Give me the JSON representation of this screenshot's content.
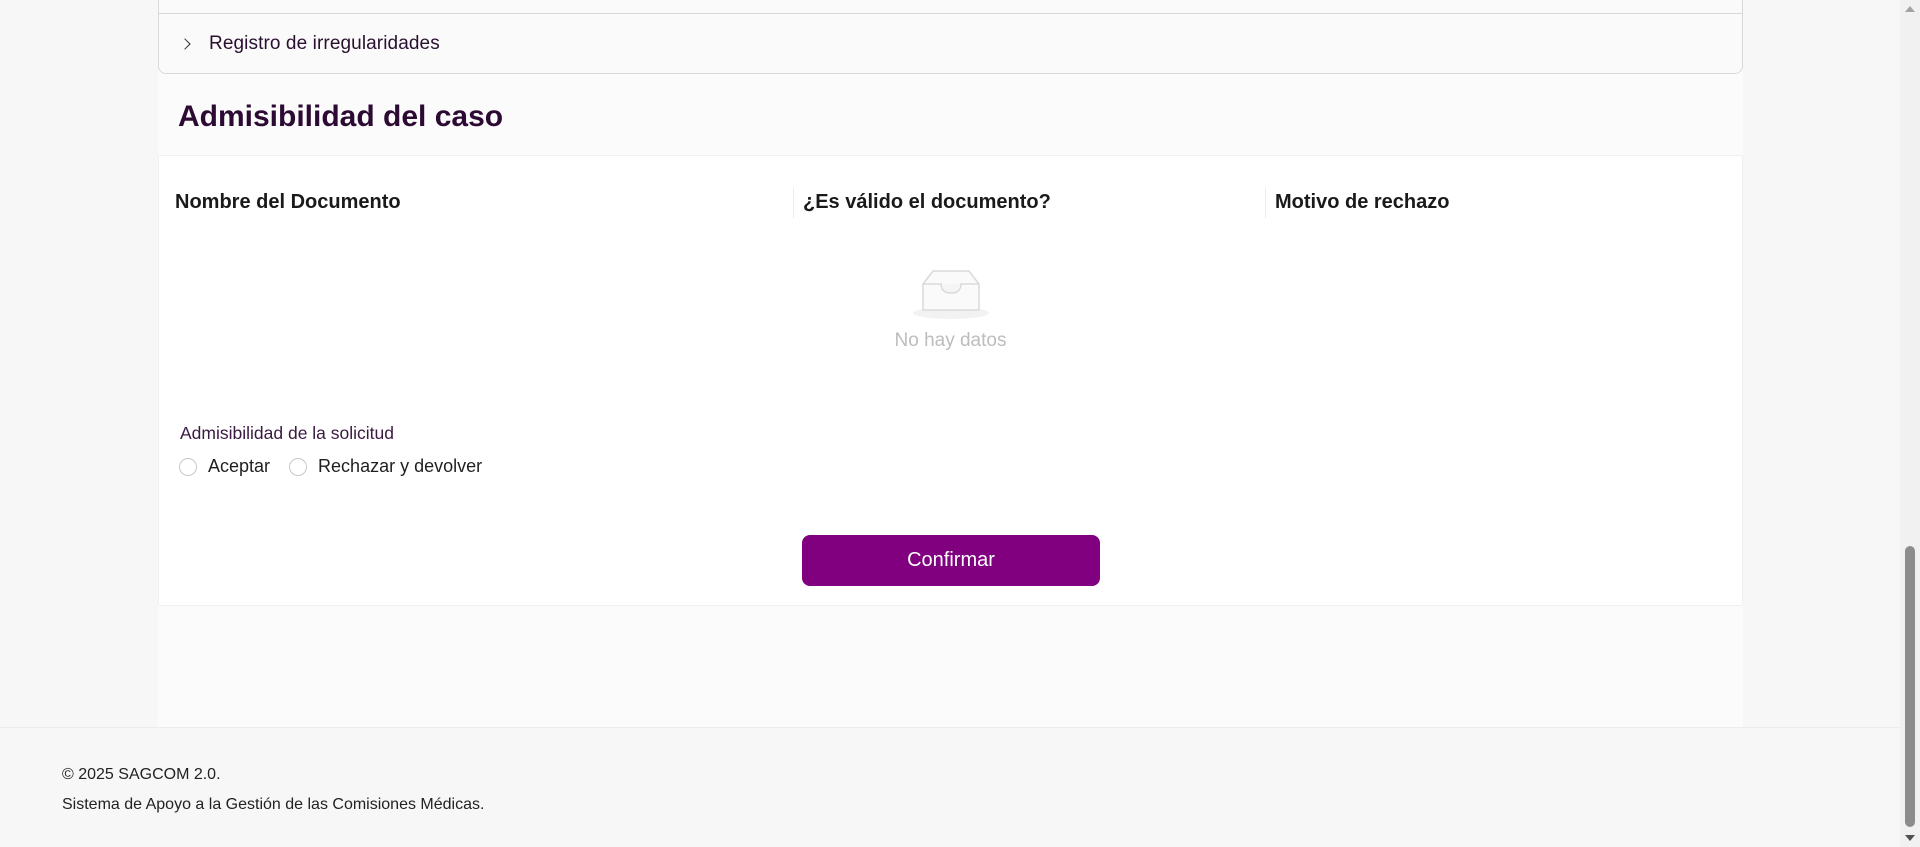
{
  "collapse": {
    "label": "Registro de irregularidades",
    "icon": "chevron-right-icon"
  },
  "section": {
    "title": "Admisibilidad del caso"
  },
  "table": {
    "columns": [
      "Nombre del Documento",
      "¿Es válido el documento?",
      "Motivo de rechazo"
    ],
    "rows": [],
    "empty_text": "No hay datos",
    "empty_icon": "inbox-icon"
  },
  "admissibility": {
    "label": "Admisibilidad de la solicitud",
    "options": [
      "Aceptar",
      "Rechazar y devolver"
    ],
    "selected": null
  },
  "actions": {
    "confirm_label": "Confirmar",
    "confirm_color": "#800080"
  },
  "footer": {
    "copyright": "© 2025 SAGCOM 2.0.",
    "description": "Sistema de Apoyo a la Gestión de las Comisiones Médicas."
  },
  "colors": {
    "title": "#2d0a33",
    "accent": "#800080",
    "empty_text": "#bdbdbd"
  }
}
